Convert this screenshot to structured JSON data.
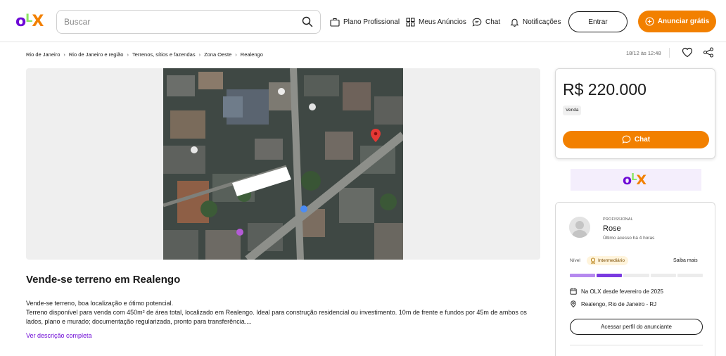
{
  "header": {
    "logo": {
      "o": "o",
      "l": "L",
      "x": "X"
    },
    "search_placeholder": "Buscar",
    "nav": {
      "plano": "Plano Profissional",
      "anuncios": "Meus Anúncios",
      "chat": "Chat",
      "notificacoes": "Notificações"
    },
    "entrar": "Entrar",
    "anunciar": "Anunciar grátis"
  },
  "breadcrumb": [
    "Rio de Janeiro",
    "Rio de Janeiro e região",
    "Terrenos, sítios e fazendas",
    "Zona Oeste",
    "Realengo"
  ],
  "posted_at": "18/12 às 12:48",
  "listing": {
    "title": "Vende-se terreno em Realengo",
    "description_lines": [
      "Vende-se terreno, boa localização e ótimo potencial.",
      "Terreno disponível para venda com 450m² de área total, localizado em Realengo. Ideal para construção residencial ou investimento. 10m de frente e fundos por 45m de ambos os lados, plano e murado; documentação regularizada, pronto para transferência...."
    ],
    "more_link": "Ver descrição completa"
  },
  "price_card": {
    "price": "R$ 220.000",
    "tag": "Venda",
    "chat_button": "Chat"
  },
  "seller": {
    "type": "PROFISSIONAL",
    "name": "Rose",
    "last_access": "Último acesso há 4 horas",
    "level_label": "Nível",
    "level": "Intermediário",
    "level_steps_filled": 2,
    "level_steps_total": 5,
    "saiba_mais": "Saiba mais",
    "since": "Na OLX desde fevereiro de 2025",
    "location": "Realengo, Rio de Janeiro - RJ",
    "profile_button": "Acessar perfil do anunciante"
  },
  "colors": {
    "orange": "#f28000",
    "purple": "#6e0ad6",
    "green": "#8ce563",
    "level_filled_1": "#b689ef",
    "level_filled_2": "#7a3ae0",
    "level_empty": "#ececec"
  }
}
